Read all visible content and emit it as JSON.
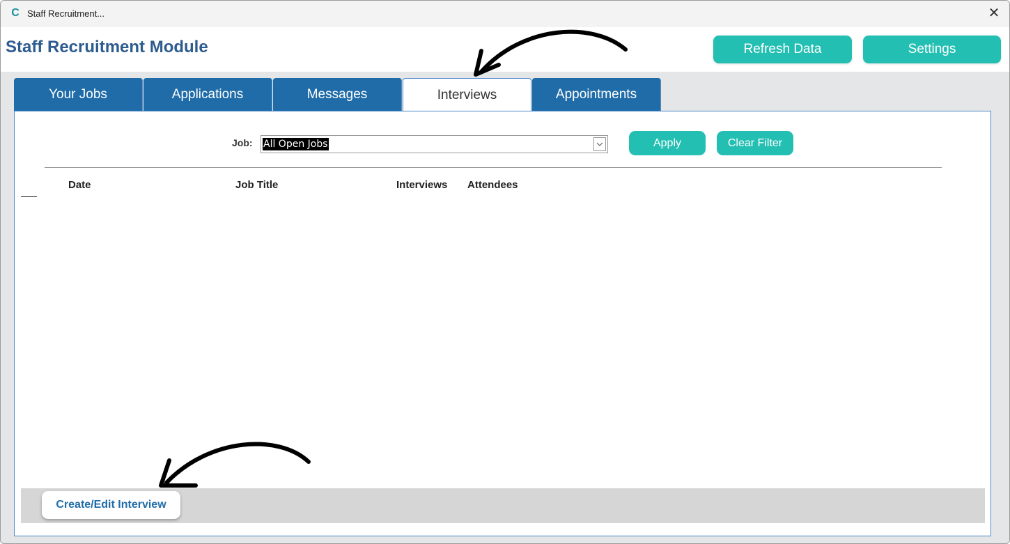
{
  "window": {
    "title": "Staff Recruitment...",
    "app_icon": "C",
    "close_glyph": "✕"
  },
  "header": {
    "module_title": "Staff Recruitment Module",
    "refresh_label": "Refresh Data",
    "settings_label": "Settings"
  },
  "tabs": [
    {
      "label": "Your Jobs",
      "active": false
    },
    {
      "label": "Applications",
      "active": false
    },
    {
      "label": "Messages",
      "active": false
    },
    {
      "label": "Interviews",
      "active": true
    },
    {
      "label": "Appointments",
      "active": false
    }
  ],
  "filter": {
    "label": "Job:",
    "selected_value": "All Open Jobs",
    "apply_label": "Apply",
    "clear_label": "Clear Filter"
  },
  "table": {
    "columns": [
      "Date",
      "Job Title",
      "Interviews",
      "Attendees"
    ],
    "rows": []
  },
  "footer": {
    "create_label": "Create/Edit Interview"
  },
  "colors": {
    "accent_teal": "#23bfb2",
    "tab_blue": "#1f6ca8",
    "title_blue": "#2d5c8e"
  }
}
